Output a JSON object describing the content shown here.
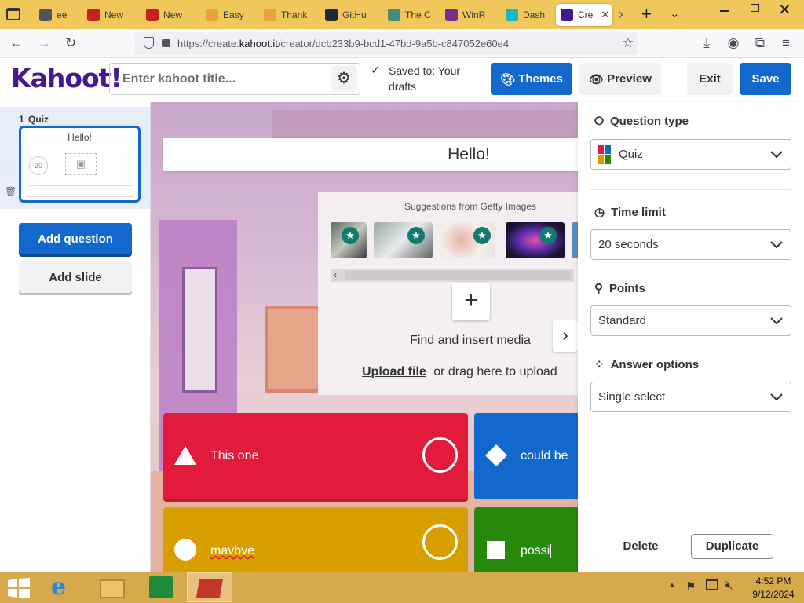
{
  "browser": {
    "tabs": [
      {
        "label": "ee",
        "icon": "back-chevron-icon",
        "color": "#555555"
      },
      {
        "label": "New",
        "icon": "gmail-icon",
        "color": "#c5221f"
      },
      {
        "label": "New",
        "icon": "gmail-icon",
        "color": "#c5221f"
      },
      {
        "label": "Easy",
        "icon": "wifi-icon",
        "color": "#e8a23a"
      },
      {
        "label": "Thank",
        "icon": "wifi-icon",
        "color": "#e8a23a"
      },
      {
        "label": "GitHu",
        "icon": "github-icon",
        "color": "#24292f"
      },
      {
        "label": "The C",
        "icon": "shield-icon",
        "color": "#4a8a7a"
      },
      {
        "label": "WinR",
        "icon": "winrar-icon",
        "color": "#7b2d8b"
      },
      {
        "label": "Dash",
        "icon": "dashboard-icon",
        "color": "#1fb6c1"
      },
      {
        "label": "Cre",
        "icon": "kahoot-icon",
        "color": "#46178f"
      }
    ],
    "url_prefix": "https://create.",
    "url_domain": "kahoot.it",
    "url_suffix": "/creator/dcb233b9-bcd1-47bd-9a5b-c847052e60e4"
  },
  "header": {
    "logo": "Kahoot!",
    "title_placeholder": "Enter kahoot title...",
    "saved_text": "Saved to: Your drafts",
    "themes_label": "Themes",
    "preview_label": "Preview",
    "exit_label": "Exit",
    "save_label": "Save"
  },
  "sidebar": {
    "slide_number": "1",
    "slide_type": "Quiz",
    "slide_title": "Hello!",
    "slide_timer": "20",
    "add_question_label": "Add question",
    "add_slide_label": "Add slide"
  },
  "editor": {
    "question_title": "Hello!",
    "media_suggestions_label": "Suggestions from Getty Images",
    "find_media_label": "Find and insert media",
    "upload_file_label": "Upload file",
    "drag_label": "or drag here to upload",
    "answers": [
      {
        "text": "This one",
        "color": "#e21b3c",
        "shape": "triangle"
      },
      {
        "text": "could be",
        "color": "#1368ce",
        "shape": "diamond"
      },
      {
        "text": "mavbve",
        "color": "#d89e00",
        "shape": "circle"
      },
      {
        "text": "possi",
        "color": "#26890c",
        "shape": "square"
      }
    ]
  },
  "settings": {
    "question_type_label": "Question type",
    "question_type_value": "Quiz",
    "time_limit_label": "Time limit",
    "time_limit_value": "20 seconds",
    "points_label": "Points",
    "points_value": "Standard",
    "answer_options_label": "Answer options",
    "answer_options_value": "Single select",
    "delete_label": "Delete",
    "duplicate_label": "Duplicate"
  },
  "taskbar": {
    "time": "4:52 PM",
    "date": "9/12/2024"
  }
}
